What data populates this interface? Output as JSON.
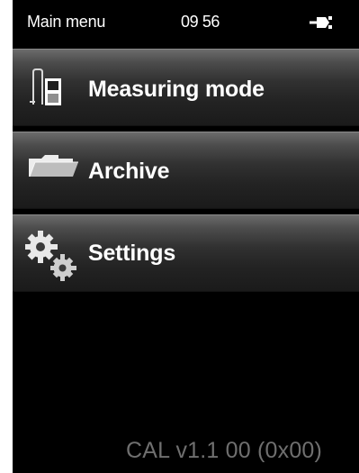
{
  "status_bar": {
    "title": "Main menu",
    "time": "09 56",
    "power_icon": "power-plug-icon"
  },
  "menu": {
    "items": [
      {
        "label": "Measuring mode",
        "icon": "measuring-probe-icon"
      },
      {
        "label": "Archive",
        "icon": "folder-icon"
      },
      {
        "label": "Settings",
        "icon": "gears-icon"
      }
    ]
  },
  "footer": {
    "version_text": "CAL v1.1 00 (0x00)"
  },
  "colors": {
    "screen_background": "#000000",
    "menu_gradient_top": "#6d6d6d",
    "menu_gradient_bottom": "#1a1a1a",
    "text_primary": "#ffffff",
    "text_secondary": "#6f6f6f"
  }
}
